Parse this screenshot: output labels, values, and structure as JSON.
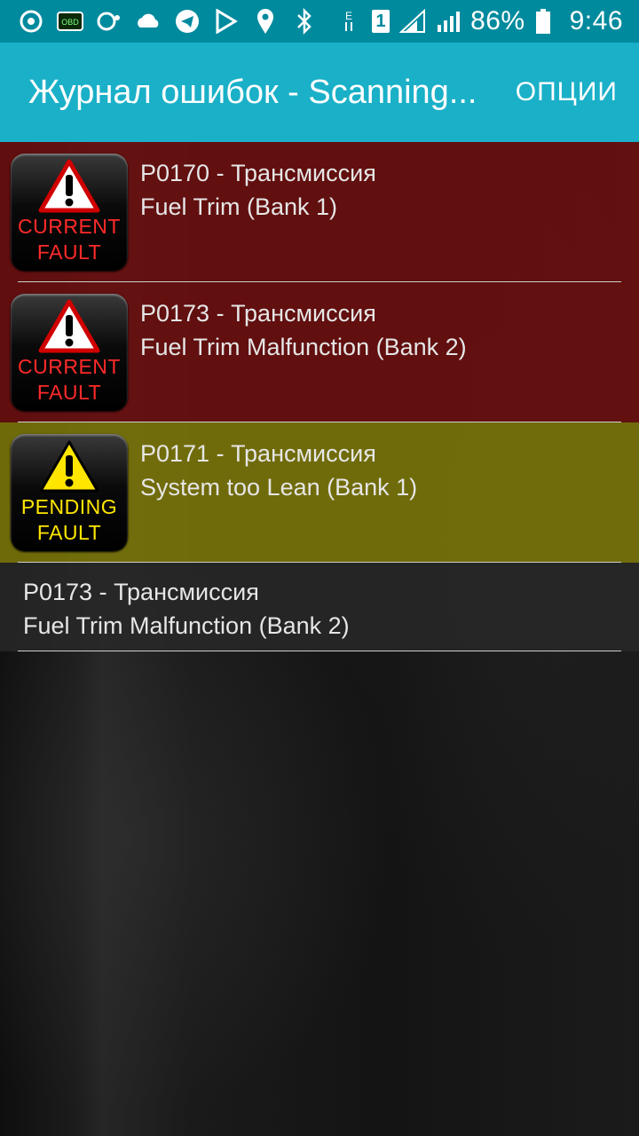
{
  "statusbar": {
    "battery": "86%",
    "time": "9:46",
    "sim": "1",
    "icons": [
      "sync-icon",
      "obd-icon",
      "weather-icon",
      "cloud-icon",
      "telegram-icon",
      "play-store-icon",
      "location-icon",
      "bluetooth-icon",
      "data-icon",
      "signal-icon",
      "signal-icon",
      "battery-icon"
    ]
  },
  "actionbar": {
    "title": "Журнал ошибок - Scanning...",
    "options": "ОПЦИИ"
  },
  "faults": [
    {
      "type": "current",
      "badge_line1": "CURRENT",
      "badge_line2": "FAULT",
      "code": "P0170 - Трансмиссия",
      "desc": "Fuel Trim (Bank 1)"
    },
    {
      "type": "current",
      "badge_line1": "CURRENT",
      "badge_line2": "FAULT",
      "code": "P0173 - Трансмиссия",
      "desc": "Fuel Trim Malfunction (Bank 2)"
    },
    {
      "type": "pending",
      "badge_line1": "PENDING",
      "badge_line2": "FAULT",
      "code": "P0171 - Трансмиссия",
      "desc": "System too Lean (Bank 1)"
    },
    {
      "type": "plain",
      "code": "P0173 - Трансмиссия",
      "desc": "Fuel Trim Malfunction (Bank 2)"
    }
  ],
  "colors": {
    "statusbar": "#008a9e",
    "actionbar": "#1ab0c8",
    "current_row": "#6e0e0e",
    "pending_row": "#807a08",
    "current_text": "#ff2a2a",
    "pending_text": "#ffe600"
  }
}
